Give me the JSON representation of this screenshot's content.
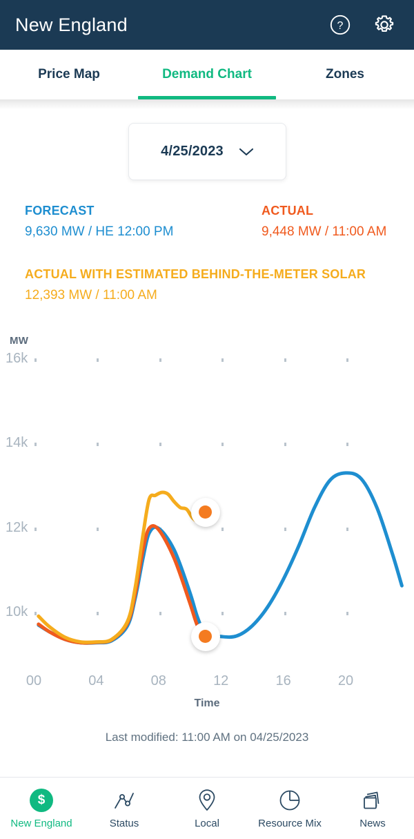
{
  "header": {
    "title": "New England",
    "help_icon": "help-circle-icon",
    "settings_icon": "gear-icon"
  },
  "tabs": [
    {
      "label": "Price Map",
      "active": false
    },
    {
      "label": "Demand Chart",
      "active": true
    },
    {
      "label": "Zones",
      "active": false
    }
  ],
  "date_select": {
    "value": "4/25/2023",
    "chevron_icon": "chevron-down-icon"
  },
  "legend": [
    {
      "title": "FORECAST",
      "value": "9,630 MW / HE 12:00 PM",
      "color": "#1e8ed0"
    },
    {
      "title": "ACTUAL",
      "value": "9,448 MW / 11:00 AM",
      "color": "#f05a1e"
    },
    {
      "title": "ACTUAL WITH ESTIMATED BEHIND-THE-METER SOLAR",
      "value": "12,393 MW / 11:00 AM",
      "color": "#f5ac1d"
    }
  ],
  "chart_data": {
    "type": "line",
    "title": "",
    "xlabel": "Time",
    "ylabel": "MW",
    "y_unit_label": "MW",
    "grid": "dotted",
    "legend_position": "above-chart",
    "xlim": [
      0,
      24
    ],
    "ylim": [
      8800,
      16400
    ],
    "x_ticks": [
      "00",
      "04",
      "08",
      "12",
      "16",
      "20"
    ],
    "x_tick_values": [
      0,
      4,
      8,
      12,
      16,
      20
    ],
    "y_ticks": [
      "10k",
      "12k",
      "14k",
      "16k"
    ],
    "y_tick_values": [
      10000,
      12000,
      14000,
      16000
    ],
    "series": [
      {
        "name": "FORECAST",
        "color": "#1e8ed0",
        "x": [
          0.3,
          1,
          2,
          3,
          4,
          5,
          6,
          6.5,
          7,
          7.4,
          8,
          9,
          10,
          10.5,
          11,
          12,
          13,
          14,
          15,
          16,
          17,
          18,
          19,
          20,
          21,
          22,
          23,
          23.6
        ],
        "values": [
          9720,
          9560,
          9380,
          9300,
          9300,
          9350,
          9700,
          10350,
          11300,
          11900,
          12010,
          11500,
          10500,
          9900,
          9520,
          9448,
          9460,
          9700,
          10150,
          10800,
          11600,
          12500,
          13150,
          13320,
          13180,
          12500,
          11400,
          10650
        ]
      },
      {
        "name": "ACTUAL",
        "color": "#f05a1e",
        "x": [
          0.3,
          1,
          2,
          3,
          4,
          5,
          6,
          6.5,
          7,
          7.4,
          8,
          9,
          10,
          10.5,
          11
        ],
        "values": [
          9740,
          9560,
          9380,
          9300,
          9310,
          9370,
          9760,
          10450,
          11500,
          12010,
          11980,
          11300,
          10250,
          9700,
          9448
        ]
      },
      {
        "name": "ACTUAL WITH ESTIMATED BEHIND-THE-METER SOLAR",
        "color": "#f5ac1d",
        "x": [
          0.3,
          1,
          2,
          3,
          4,
          5,
          6,
          6.5,
          7,
          7.4,
          7.8,
          8.2,
          8.6,
          9,
          9.4,
          9.8,
          10.2,
          10.6,
          11
        ],
        "values": [
          9930,
          9680,
          9430,
          9320,
          9320,
          9380,
          9800,
          10600,
          11850,
          12700,
          12790,
          12860,
          12820,
          12640,
          12500,
          12460,
          12250,
          12180,
          12393
        ]
      }
    ],
    "markers": [
      {
        "series": "ACTUAL WITH ESTIMATED BEHIND-THE-METER SOLAR",
        "x": 11,
        "value": 12393,
        "color": "#f47b20"
      },
      {
        "series": "ACTUAL",
        "x": 11,
        "value": 9448,
        "color": "#f47b20"
      }
    ]
  },
  "footer": {
    "last_modified": "Last modified: 11:00 AM on 04/25/2023"
  },
  "bottom_nav": [
    {
      "label": "New England",
      "icon": "dollar-badge-icon",
      "active": true
    },
    {
      "label": "Status",
      "icon": "line-chart-icon",
      "active": false
    },
    {
      "label": "Local",
      "icon": "map-pin-icon",
      "active": false
    },
    {
      "label": "Resource Mix",
      "icon": "pie-chart-icon",
      "active": false
    },
    {
      "label": "News",
      "icon": "news-cards-icon",
      "active": false
    }
  ],
  "colors": {
    "header_bg": "#1b3a54",
    "accent_green": "#10b981",
    "forecast_blue": "#1e8ed0",
    "actual_orange": "#f05a1e",
    "solar_yellow": "#f5ac1d"
  }
}
